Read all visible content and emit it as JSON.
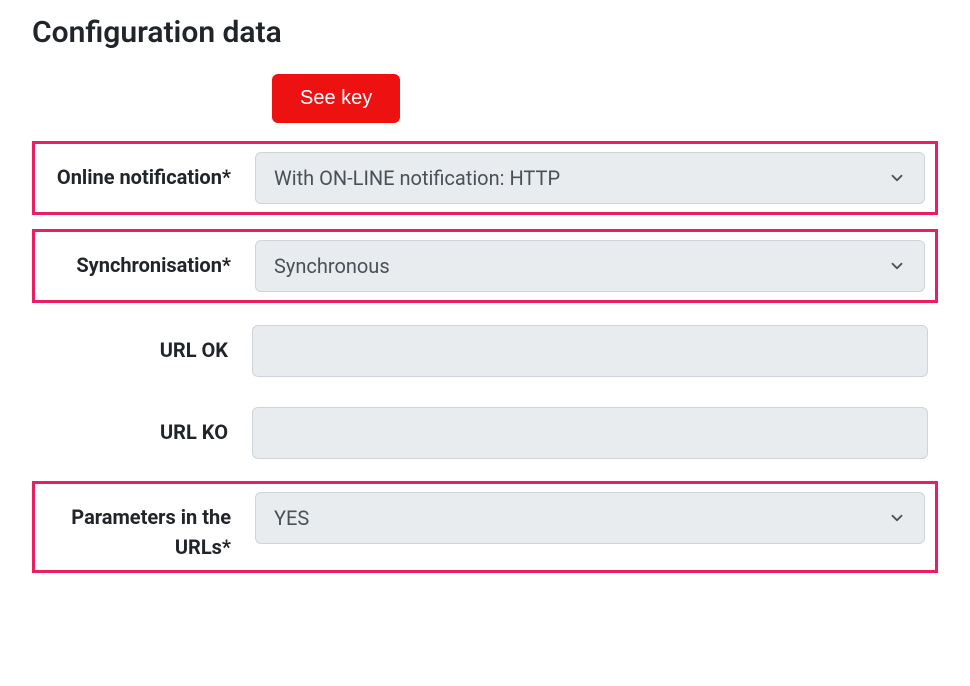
{
  "title": "Configuration data",
  "actions": {
    "see_key_label": "See key"
  },
  "fields": {
    "online_notification": {
      "label": "Online notification*",
      "value": "With ON-LINE notification: HTTP"
    },
    "synchronisation": {
      "label": "Synchronisation*",
      "value": "Synchronous"
    },
    "url_ok": {
      "label": "URL OK",
      "value": ""
    },
    "url_ko": {
      "label": "URL KO",
      "value": ""
    },
    "parameters_in_urls": {
      "label": "Parameters in the URLs*",
      "value": "YES"
    }
  }
}
